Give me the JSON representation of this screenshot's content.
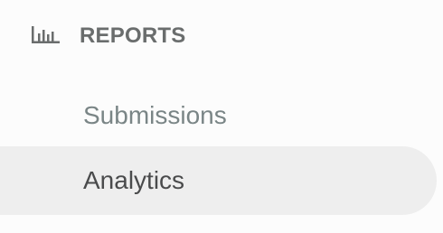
{
  "colors": {
    "background": "#fcfcfc",
    "section_text": "#6a6d6d",
    "item_text": "#7a8586",
    "active_item_text": "#4a4b4c",
    "active_item_background": "#eeeeee"
  },
  "sidebar": {
    "section": {
      "icon": "bar-chart-icon",
      "title": "REPORTS"
    },
    "items": [
      {
        "label": "Submissions",
        "active": false
      },
      {
        "label": "Analytics",
        "active": true
      }
    ]
  }
}
